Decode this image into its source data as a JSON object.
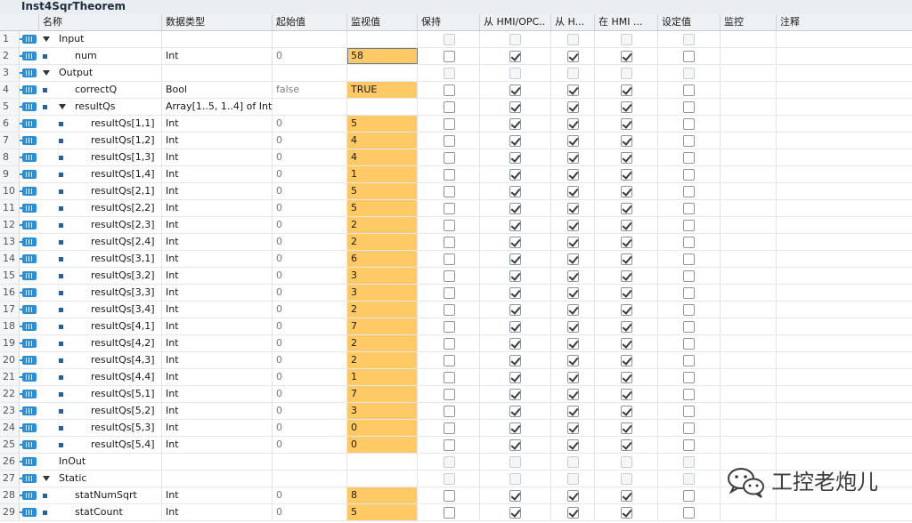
{
  "window": {
    "title": "Inst4SqrTheorem"
  },
  "columns": {
    "name": "名称",
    "type": "数据类型",
    "start": "起始值",
    "monitor": "监视值",
    "retain": "保持",
    "hmiopc": "从 HMI/OPC..",
    "fromhmi": "从 H...",
    "inhmi": "在 HMI ...",
    "setpoint": "设定值",
    "watch": "监控",
    "comment": "注释"
  },
  "rows": [
    {
      "n": "1",
      "name": "Input",
      "level": 0,
      "kind": "section",
      "expand": true
    },
    {
      "n": "2",
      "name": "num",
      "level": 1,
      "kind": "var",
      "type": "Int",
      "start": "0",
      "monitor": "58",
      "checks": [
        false,
        true,
        true,
        true,
        false
      ],
      "active": true
    },
    {
      "n": "3",
      "name": "Output",
      "level": 0,
      "kind": "section",
      "expand": true
    },
    {
      "n": "4",
      "name": "correctQ",
      "level": 1,
      "kind": "var",
      "type": "Bool",
      "start": "false",
      "monitor": "TRUE",
      "checks": [
        false,
        true,
        true,
        true,
        false
      ]
    },
    {
      "n": "5",
      "name": "resultQs",
      "level": 1,
      "kind": "array",
      "expand": true,
      "type": "Array[1..5, 1..4] of Int",
      "start": "",
      "monitor": "",
      "checks": [
        false,
        true,
        true,
        true,
        false
      ]
    },
    {
      "n": "6",
      "name": "resultQs[1,1]",
      "level": 2,
      "kind": "var",
      "type": "Int",
      "start": "0",
      "monitor": "5",
      "checks": [
        false,
        true,
        true,
        true,
        false
      ]
    },
    {
      "n": "7",
      "name": "resultQs[1,2]",
      "level": 2,
      "kind": "var",
      "type": "Int",
      "start": "0",
      "monitor": "4",
      "checks": [
        false,
        true,
        true,
        true,
        false
      ]
    },
    {
      "n": "8",
      "name": "resultQs[1,3]",
      "level": 2,
      "kind": "var",
      "type": "Int",
      "start": "0",
      "monitor": "4",
      "checks": [
        false,
        true,
        true,
        true,
        false
      ]
    },
    {
      "n": "9",
      "name": "resultQs[1,4]",
      "level": 2,
      "kind": "var",
      "type": "Int",
      "start": "0",
      "monitor": "1",
      "checks": [
        false,
        true,
        true,
        true,
        false
      ]
    },
    {
      "n": "10",
      "name": "resultQs[2,1]",
      "level": 2,
      "kind": "var",
      "type": "Int",
      "start": "0",
      "monitor": "5",
      "checks": [
        false,
        true,
        true,
        true,
        false
      ]
    },
    {
      "n": "11",
      "name": "resultQs[2,2]",
      "level": 2,
      "kind": "var",
      "type": "Int",
      "start": "0",
      "monitor": "5",
      "checks": [
        false,
        true,
        true,
        true,
        false
      ]
    },
    {
      "n": "12",
      "name": "resultQs[2,3]",
      "level": 2,
      "kind": "var",
      "type": "Int",
      "start": "0",
      "monitor": "2",
      "checks": [
        false,
        true,
        true,
        true,
        false
      ]
    },
    {
      "n": "13",
      "name": "resultQs[2,4]",
      "level": 2,
      "kind": "var",
      "type": "Int",
      "start": "0",
      "monitor": "2",
      "checks": [
        false,
        true,
        true,
        true,
        false
      ]
    },
    {
      "n": "14",
      "name": "resultQs[3,1]",
      "level": 2,
      "kind": "var",
      "type": "Int",
      "start": "0",
      "monitor": "6",
      "checks": [
        false,
        true,
        true,
        true,
        false
      ]
    },
    {
      "n": "15",
      "name": "resultQs[3,2]",
      "level": 2,
      "kind": "var",
      "type": "Int",
      "start": "0",
      "monitor": "3",
      "checks": [
        false,
        true,
        true,
        true,
        false
      ]
    },
    {
      "n": "16",
      "name": "resultQs[3,3]",
      "level": 2,
      "kind": "var",
      "type": "Int",
      "start": "0",
      "monitor": "3",
      "checks": [
        false,
        true,
        true,
        true,
        false
      ]
    },
    {
      "n": "17",
      "name": "resultQs[3,4]",
      "level": 2,
      "kind": "var",
      "type": "Int",
      "start": "0",
      "monitor": "2",
      "checks": [
        false,
        true,
        true,
        true,
        false
      ]
    },
    {
      "n": "18",
      "name": "resultQs[4,1]",
      "level": 2,
      "kind": "var",
      "type": "Int",
      "start": "0",
      "monitor": "7",
      "checks": [
        false,
        true,
        true,
        true,
        false
      ]
    },
    {
      "n": "19",
      "name": "resultQs[4,2]",
      "level": 2,
      "kind": "var",
      "type": "Int",
      "start": "0",
      "monitor": "2",
      "checks": [
        false,
        true,
        true,
        true,
        false
      ]
    },
    {
      "n": "20",
      "name": "resultQs[4,3]",
      "level": 2,
      "kind": "var",
      "type": "Int",
      "start": "0",
      "monitor": "2",
      "checks": [
        false,
        true,
        true,
        true,
        false
      ]
    },
    {
      "n": "21",
      "name": "resultQs[4,4]",
      "level": 2,
      "kind": "var",
      "type": "Int",
      "start": "0",
      "monitor": "1",
      "checks": [
        false,
        true,
        true,
        true,
        false
      ]
    },
    {
      "n": "22",
      "name": "resultQs[5,1]",
      "level": 2,
      "kind": "var",
      "type": "Int",
      "start": "0",
      "monitor": "7",
      "checks": [
        false,
        true,
        true,
        true,
        false
      ]
    },
    {
      "n": "23",
      "name": "resultQs[5,2]",
      "level": 2,
      "kind": "var",
      "type": "Int",
      "start": "0",
      "monitor": "3",
      "checks": [
        false,
        true,
        true,
        true,
        false
      ]
    },
    {
      "n": "24",
      "name": "resultQs[5,3]",
      "level": 2,
      "kind": "var",
      "type": "Int",
      "start": "0",
      "monitor": "0",
      "checks": [
        false,
        true,
        true,
        true,
        false
      ]
    },
    {
      "n": "25",
      "name": "resultQs[5,4]",
      "level": 2,
      "kind": "var",
      "type": "Int",
      "start": "0",
      "monitor": "0",
      "checks": [
        false,
        true,
        true,
        true,
        false
      ]
    },
    {
      "n": "26",
      "name": "InOut",
      "level": 0,
      "kind": "section",
      "expand": false
    },
    {
      "n": "27",
      "name": "Static",
      "level": 0,
      "kind": "section",
      "expand": true
    },
    {
      "n": "28",
      "name": "statNumSqrt",
      "level": 1,
      "kind": "var",
      "type": "Int",
      "start": "0",
      "monitor": "8",
      "checks": [
        false,
        true,
        true,
        true,
        false
      ]
    },
    {
      "n": "29",
      "name": "statCount",
      "level": 1,
      "kind": "var",
      "type": "Int",
      "start": "0",
      "monitor": "5",
      "checks": [
        false,
        true,
        true,
        true,
        false
      ]
    }
  ],
  "watermark": {
    "text": "工控老炮儿",
    "icon": "wechat-icon"
  },
  "colors": {
    "monitor_bg": "#ffc966",
    "interface_icon": "#2b8ed6"
  }
}
